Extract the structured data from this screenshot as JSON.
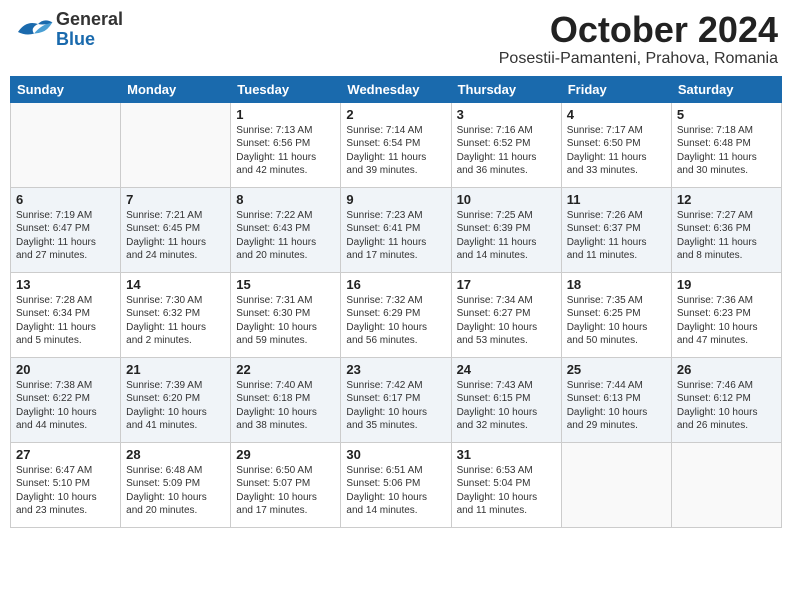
{
  "header": {
    "logo_general": "General",
    "logo_blue": "Blue",
    "month_title": "October 2024",
    "subtitle": "Posestii-Pamanteni, Prahova, Romania"
  },
  "days_of_week": [
    "Sunday",
    "Monday",
    "Tuesday",
    "Wednesday",
    "Thursday",
    "Friday",
    "Saturday"
  ],
  "weeks": [
    [
      {
        "day": "",
        "content": ""
      },
      {
        "day": "",
        "content": ""
      },
      {
        "day": "1",
        "content": "Sunrise: 7:13 AM\nSunset: 6:56 PM\nDaylight: 11 hours and 42 minutes."
      },
      {
        "day": "2",
        "content": "Sunrise: 7:14 AM\nSunset: 6:54 PM\nDaylight: 11 hours and 39 minutes."
      },
      {
        "day": "3",
        "content": "Sunrise: 7:16 AM\nSunset: 6:52 PM\nDaylight: 11 hours and 36 minutes."
      },
      {
        "day": "4",
        "content": "Sunrise: 7:17 AM\nSunset: 6:50 PM\nDaylight: 11 hours and 33 minutes."
      },
      {
        "day": "5",
        "content": "Sunrise: 7:18 AM\nSunset: 6:48 PM\nDaylight: 11 hours and 30 minutes."
      }
    ],
    [
      {
        "day": "6",
        "content": "Sunrise: 7:19 AM\nSunset: 6:47 PM\nDaylight: 11 hours and 27 minutes."
      },
      {
        "day": "7",
        "content": "Sunrise: 7:21 AM\nSunset: 6:45 PM\nDaylight: 11 hours and 24 minutes."
      },
      {
        "day": "8",
        "content": "Sunrise: 7:22 AM\nSunset: 6:43 PM\nDaylight: 11 hours and 20 minutes."
      },
      {
        "day": "9",
        "content": "Sunrise: 7:23 AM\nSunset: 6:41 PM\nDaylight: 11 hours and 17 minutes."
      },
      {
        "day": "10",
        "content": "Sunrise: 7:25 AM\nSunset: 6:39 PM\nDaylight: 11 hours and 14 minutes."
      },
      {
        "day": "11",
        "content": "Sunrise: 7:26 AM\nSunset: 6:37 PM\nDaylight: 11 hours and 11 minutes."
      },
      {
        "day": "12",
        "content": "Sunrise: 7:27 AM\nSunset: 6:36 PM\nDaylight: 11 hours and 8 minutes."
      }
    ],
    [
      {
        "day": "13",
        "content": "Sunrise: 7:28 AM\nSunset: 6:34 PM\nDaylight: 11 hours and 5 minutes."
      },
      {
        "day": "14",
        "content": "Sunrise: 7:30 AM\nSunset: 6:32 PM\nDaylight: 11 hours and 2 minutes."
      },
      {
        "day": "15",
        "content": "Sunrise: 7:31 AM\nSunset: 6:30 PM\nDaylight: 10 hours and 59 minutes."
      },
      {
        "day": "16",
        "content": "Sunrise: 7:32 AM\nSunset: 6:29 PM\nDaylight: 10 hours and 56 minutes."
      },
      {
        "day": "17",
        "content": "Sunrise: 7:34 AM\nSunset: 6:27 PM\nDaylight: 10 hours and 53 minutes."
      },
      {
        "day": "18",
        "content": "Sunrise: 7:35 AM\nSunset: 6:25 PM\nDaylight: 10 hours and 50 minutes."
      },
      {
        "day": "19",
        "content": "Sunrise: 7:36 AM\nSunset: 6:23 PM\nDaylight: 10 hours and 47 minutes."
      }
    ],
    [
      {
        "day": "20",
        "content": "Sunrise: 7:38 AM\nSunset: 6:22 PM\nDaylight: 10 hours and 44 minutes."
      },
      {
        "day": "21",
        "content": "Sunrise: 7:39 AM\nSunset: 6:20 PM\nDaylight: 10 hours and 41 minutes."
      },
      {
        "day": "22",
        "content": "Sunrise: 7:40 AM\nSunset: 6:18 PM\nDaylight: 10 hours and 38 minutes."
      },
      {
        "day": "23",
        "content": "Sunrise: 7:42 AM\nSunset: 6:17 PM\nDaylight: 10 hours and 35 minutes."
      },
      {
        "day": "24",
        "content": "Sunrise: 7:43 AM\nSunset: 6:15 PM\nDaylight: 10 hours and 32 minutes."
      },
      {
        "day": "25",
        "content": "Sunrise: 7:44 AM\nSunset: 6:13 PM\nDaylight: 10 hours and 29 minutes."
      },
      {
        "day": "26",
        "content": "Sunrise: 7:46 AM\nSunset: 6:12 PM\nDaylight: 10 hours and 26 minutes."
      }
    ],
    [
      {
        "day": "27",
        "content": "Sunrise: 6:47 AM\nSunset: 5:10 PM\nDaylight: 10 hours and 23 minutes."
      },
      {
        "day": "28",
        "content": "Sunrise: 6:48 AM\nSunset: 5:09 PM\nDaylight: 10 hours and 20 minutes."
      },
      {
        "day": "29",
        "content": "Sunrise: 6:50 AM\nSunset: 5:07 PM\nDaylight: 10 hours and 17 minutes."
      },
      {
        "day": "30",
        "content": "Sunrise: 6:51 AM\nSunset: 5:06 PM\nDaylight: 10 hours and 14 minutes."
      },
      {
        "day": "31",
        "content": "Sunrise: 6:53 AM\nSunset: 5:04 PM\nDaylight: 10 hours and 11 minutes."
      },
      {
        "day": "",
        "content": ""
      },
      {
        "day": "",
        "content": ""
      }
    ]
  ]
}
